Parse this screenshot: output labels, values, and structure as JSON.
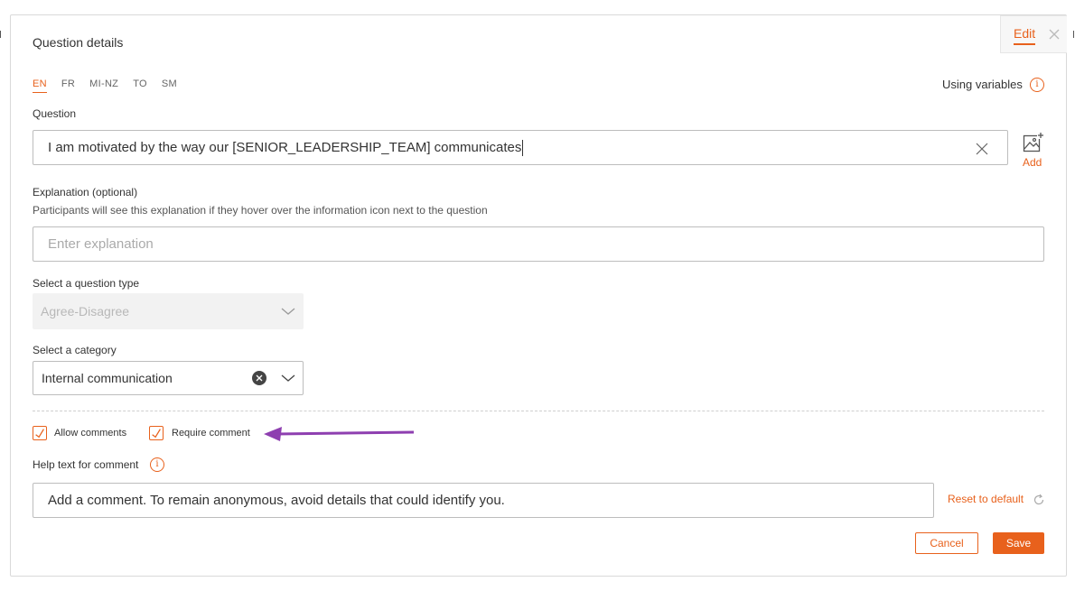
{
  "panel": {
    "title": "Question details",
    "edit_tab": "Edit",
    "close_icon": "close-icon"
  },
  "languages": [
    "EN",
    "FR",
    "MI-NZ",
    "TO",
    "SM"
  ],
  "active_language": "EN",
  "using_variables": {
    "label": "Using variables",
    "icon": "info-icon",
    "icon_glyph": "i"
  },
  "question": {
    "label": "Question",
    "value": "I am motivated by the way our [SENIOR_LEADERSHIP_TEAM] communicates",
    "add_image_label": "Add"
  },
  "explanation": {
    "label": "Explanation (optional)",
    "hint": "Participants will see this explanation if they hover over the information icon next to the question",
    "placeholder": "Enter explanation",
    "value": ""
  },
  "question_type": {
    "label": "Select a question type",
    "selected": "Agree-Disagree",
    "disabled": true
  },
  "category": {
    "label": "Select a category",
    "selected": "Internal communication"
  },
  "comments": {
    "allow_label": "Allow comments",
    "allow_checked": true,
    "require_label": "Require comment",
    "require_checked": true
  },
  "help_text": {
    "label": "Help text for comment",
    "info_glyph": "i",
    "value": "Add a comment. To remain anonymous, avoid details that could identify you.",
    "reset_label": "Reset to default"
  },
  "actions": {
    "cancel_label": "Cancel",
    "save_label": "Save"
  },
  "colors": {
    "accent": "#e8611c",
    "annotation_arrow": "#8e3fb0",
    "border": "#bdbdbd"
  }
}
